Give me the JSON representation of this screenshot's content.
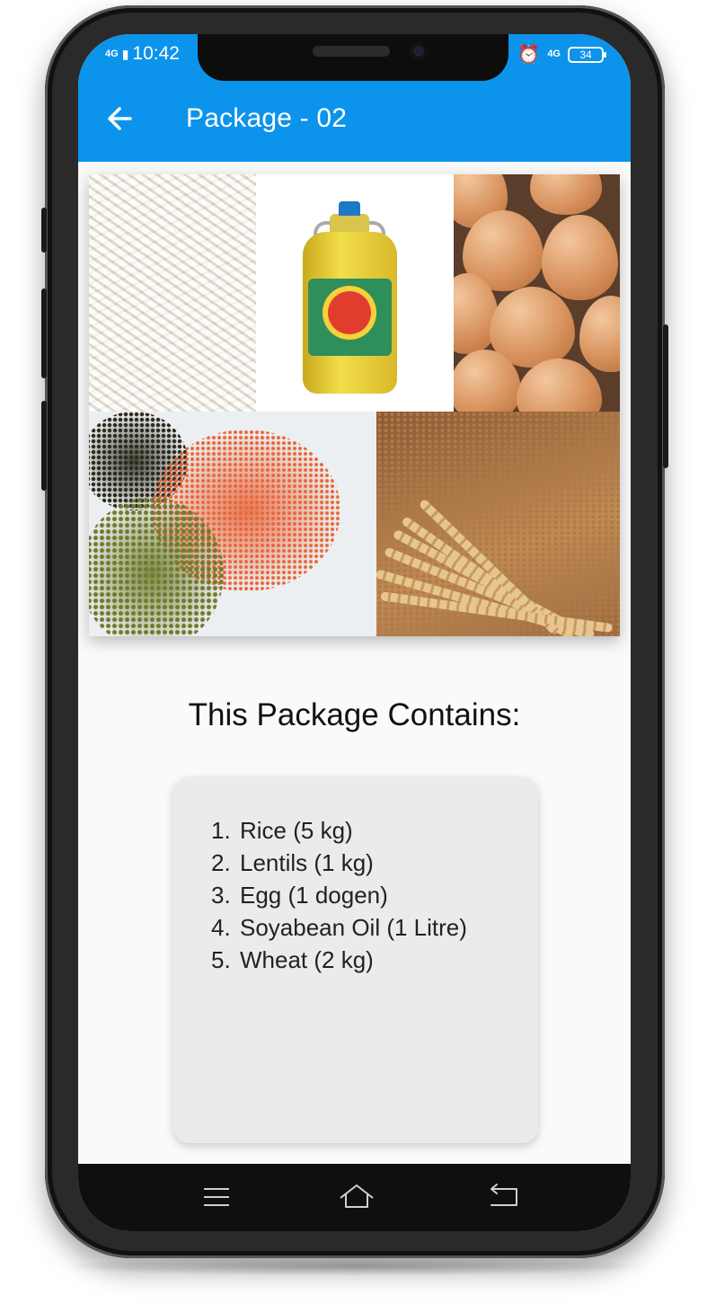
{
  "status_bar": {
    "network_left": "4G",
    "time": "10:42",
    "network_right": "4G",
    "battery": "34"
  },
  "app_bar": {
    "title": "Package - 02",
    "back_icon": "arrow-left-icon",
    "color": "#0c93ec"
  },
  "collage": {
    "images": [
      "rice-image",
      "soyabean-oil-image",
      "eggs-image",
      "lentils-image",
      "wheat-image"
    ]
  },
  "contents": {
    "heading": "This Package Contains:",
    "items": [
      {
        "num": "1.",
        "text": "Rice (5 kg)"
      },
      {
        "num": "2.",
        "text": "Lentils (1 kg)"
      },
      {
        "num": "3.",
        "text": "Egg (1 dogen)"
      },
      {
        "num": "4.",
        "text": "Soyabean Oil (1 Litre)"
      },
      {
        "num": "5.",
        "text": "Wheat (2 kg)"
      }
    ]
  },
  "nav_bar": {
    "icons": [
      "menu-icon",
      "home-icon",
      "back-icon"
    ]
  }
}
